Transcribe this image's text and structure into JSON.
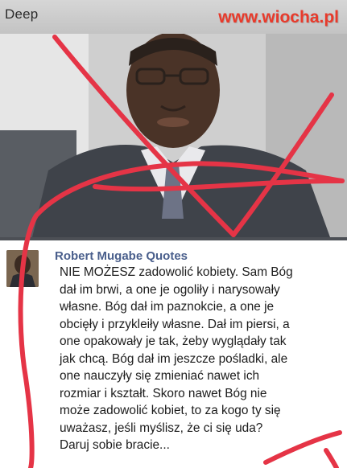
{
  "header": {
    "label": "Deep",
    "watermark": "www.wiocha.pl"
  },
  "post": {
    "author": "Robert Mugabe Quotes",
    "text_lines": [
      "NIE MOŻESZ zadowolić kobiety. Sam Bóg",
      "dał im brwi, a one je ogoliły i narysowały",
      "własne. Bóg dał im paznokcie, a one je",
      "obcięły i przykleiły własne. Dał im piersi, a",
      "one opakowały je tak, żeby wyglądały tak",
      "jak chcą. Bóg dał im jeszcze pośladki, ale",
      "one nauczyły się zmieniać nawet ich",
      "rozmiar i kształt. Skoro nawet Bóg nie",
      "może zadowolić kobiet, to za kogo ty się",
      "uważasz, jeśli myślisz, że ci się uda?",
      "Daruj sobie bracie..."
    ]
  },
  "colors": {
    "watermark": "#e83a2b",
    "author": "#4a5f8c",
    "scribble": "#e53446"
  },
  "icons": {
    "avatar": "author-avatar-photo",
    "photo": "portrait-photo"
  }
}
